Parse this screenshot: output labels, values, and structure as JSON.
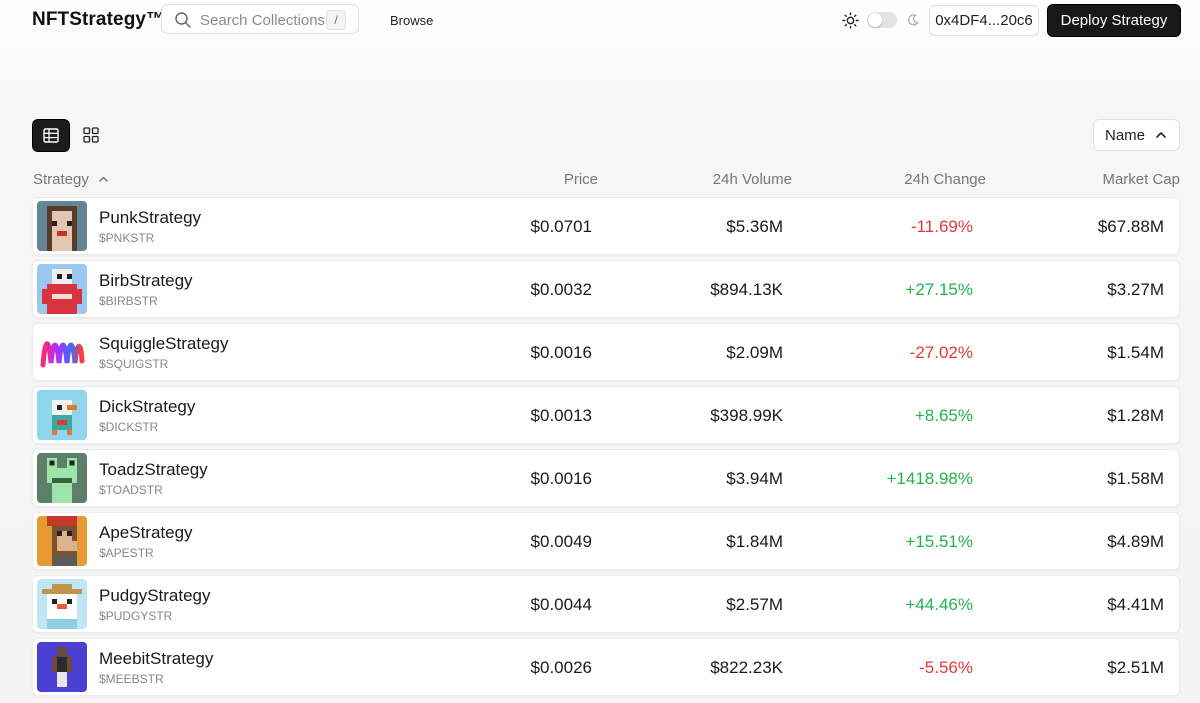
{
  "header": {
    "brand": "NFTStrategy™",
    "search": {
      "placeholder": "Search Collections",
      "shortcut": "/"
    },
    "nav_browse": "Browse",
    "theme_toggle": {
      "sun_icon": "sun-icon",
      "moon_icon": "moon-icon",
      "mode": "light"
    },
    "wallet_address": "0x4DF4...20c6",
    "deploy_label": "Deploy Strategy"
  },
  "view_controls": {
    "active_view": "table",
    "table_icon": "table-view-icon",
    "grid_icon": "grid-view-icon",
    "sort": {
      "label": "Name",
      "direction": "ascending"
    }
  },
  "table": {
    "columns": {
      "strategy": "Strategy",
      "price": "Price",
      "volume": "24h Volume",
      "change": "24h Change",
      "market_cap": "Market Cap"
    },
    "rows": [
      {
        "name": "PunkStrategy",
        "ticker": "$PNKSTR",
        "price": "$0.0701",
        "volume": "$5.36M",
        "change": "-11.69%",
        "market_cap": "$67.88M",
        "avatar": "punk-avatar"
      },
      {
        "name": "BirbStrategy",
        "ticker": "$BIRBSTR",
        "price": "$0.0032",
        "volume": "$894.13K",
        "change": "+27.15%",
        "market_cap": "$3.27M",
        "avatar": "birb-avatar"
      },
      {
        "name": "SquiggleStrategy",
        "ticker": "$SQUIGSTR",
        "price": "$0.0016",
        "volume": "$2.09M",
        "change": "-27.02%",
        "market_cap": "$1.54M",
        "avatar": "squiggle-avatar"
      },
      {
        "name": "DickStrategy",
        "ticker": "$DICKSTR",
        "price": "$0.0013",
        "volume": "$398.99K",
        "change": "+8.65%",
        "market_cap": "$1.28M",
        "avatar": "dick-avatar"
      },
      {
        "name": "ToadzStrategy",
        "ticker": "$TOADSTR",
        "price": "$0.0016",
        "volume": "$3.94M",
        "change": "+1418.98%",
        "market_cap": "$1.58M",
        "avatar": "toadz-avatar"
      },
      {
        "name": "ApeStrategy",
        "ticker": "$APESTR",
        "price": "$0.0049",
        "volume": "$1.84M",
        "change": "+15.51%",
        "market_cap": "$4.89M",
        "avatar": "ape-avatar"
      },
      {
        "name": "PudgyStrategy",
        "ticker": "$PUDGYSTR",
        "price": "$0.0044",
        "volume": "$2.57M",
        "change": "+44.46%",
        "market_cap": "$4.41M",
        "avatar": "pudgy-avatar"
      },
      {
        "name": "MeebitStrategy",
        "ticker": "$MEEBSTR",
        "price": "$0.0026",
        "volume": "$822.23K",
        "change": "-5.56%",
        "market_cap": "$2.51M",
        "avatar": "meebit-avatar"
      }
    ]
  },
  "colors": {
    "positive": "#22b34a",
    "negative": "#e03a3a",
    "primary_button": "#181818"
  }
}
